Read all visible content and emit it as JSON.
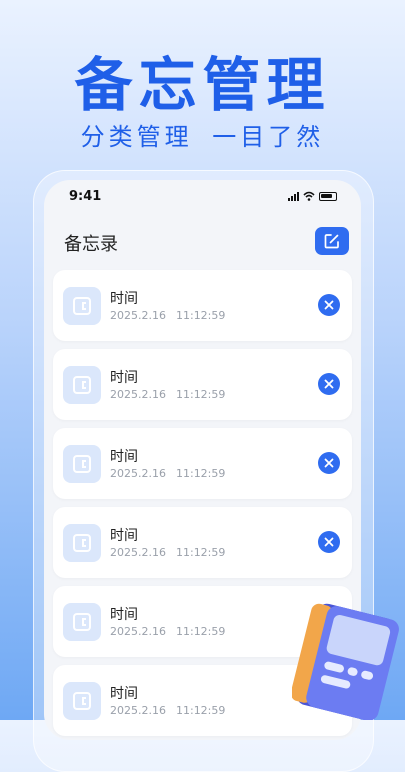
{
  "hero": {
    "title": "备忘管理",
    "subtitle": "分类管理  一目了然"
  },
  "status_bar": {
    "time": "9:41"
  },
  "header": {
    "title": "备忘录",
    "add_icon": "edit-icon"
  },
  "notes": [
    {
      "title": "时间",
      "date": "2025.2.16",
      "time": "11:12:59",
      "deletable": true
    },
    {
      "title": "时间",
      "date": "2025.2.16",
      "time": "11:12:59",
      "deletable": true
    },
    {
      "title": "时间",
      "date": "2025.2.16",
      "time": "11:12:59",
      "deletable": true
    },
    {
      "title": "时间",
      "date": "2025.2.16",
      "time": "11:12:59",
      "deletable": true
    },
    {
      "title": "时间",
      "date": "2025.2.16",
      "time": "11:12:59",
      "deletable": false
    },
    {
      "title": "时间",
      "date": "2025.2.16",
      "time": "11:12:59",
      "deletable": false
    }
  ],
  "colors": {
    "accent": "#2f6cf0",
    "hero_text": "#1f5fe8",
    "icon_bg": "#dbe7fb"
  }
}
